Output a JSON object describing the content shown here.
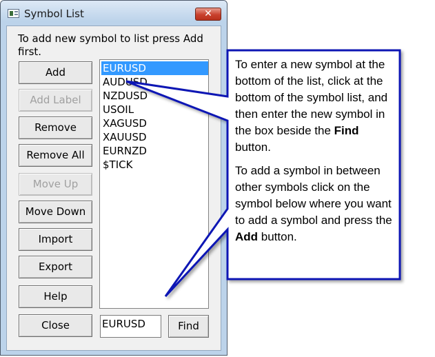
{
  "window": {
    "title": "Symbol List",
    "close_glyph": "✕"
  },
  "instruction": "To add new symbol to list press Add first.",
  "buttons": {
    "add": "Add",
    "add_label": "Add Label",
    "remove": "Remove",
    "remove_all": "Remove All",
    "move_up": "Move Up",
    "move_down": "Move Down",
    "import": "Import",
    "export": "Export",
    "help": "Help",
    "close": "Close",
    "find": "Find"
  },
  "symbols": [
    "EURUSD",
    "AUDUSD",
    "NZDUSD",
    "USOIL",
    "XAGUSD",
    "XAUUSD",
    "EURNZD",
    "$TICK"
  ],
  "selected_symbol": "EURUSD",
  "entry_value": "EURUSD",
  "callout": {
    "p1_a": "To enter a new symbol at the bottom of the list, click at the bottom of the symbol list, and then enter the new symbol in the box beside the ",
    "p1_bold": "Find",
    "p1_b": " button.",
    "p2_a": "To add a symbol in between other symbols click on the symbol below where you want to add a symbol and press the ",
    "p2_bold": "Add",
    "p2_b": " button."
  },
  "colors": {
    "selection": "#3399ff",
    "callout_border": "#0a14b4"
  }
}
